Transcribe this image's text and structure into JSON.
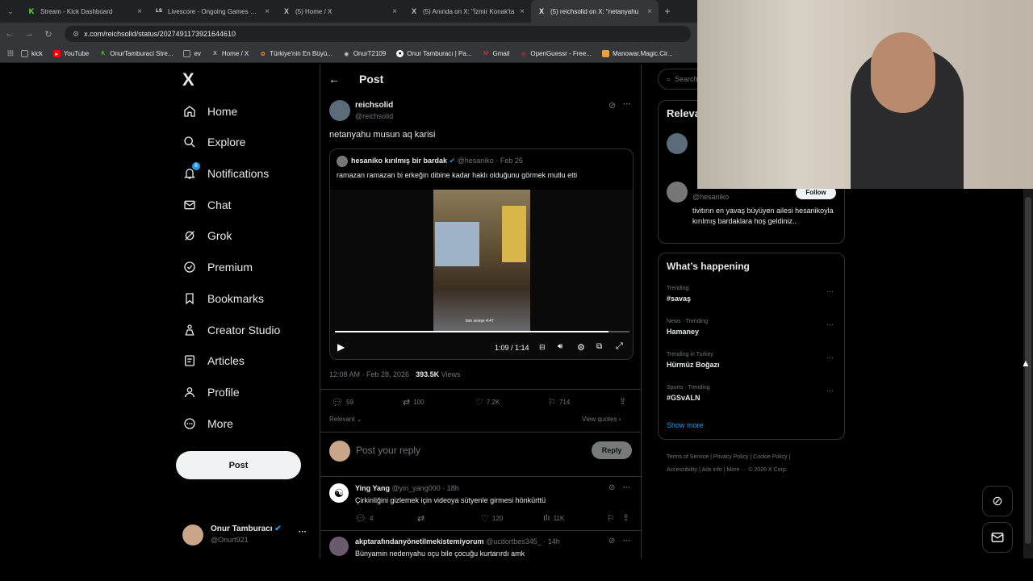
{
  "browser": {
    "tabs": [
      {
        "label": "Stream - Kick Dashboard",
        "icon": "K",
        "active": false
      },
      {
        "label": "Livescore - Ongoing Games and",
        "icon": "LS",
        "active": false
      },
      {
        "label": "(5) Home / X",
        "icon": "X",
        "active": false
      },
      {
        "label": "(5) Anında on X: \"İzmir Konak'ta",
        "icon": "X",
        "active": false
      },
      {
        "label": "(5) reichsolid on X: \"netanyahu",
        "icon": "X",
        "active": true
      }
    ],
    "new_tab": "+",
    "url": "x.com/reichsolid/status/2027491173921644610",
    "bookmarks": [
      "kick",
      "YouTube",
      "OnurTamburaci Stre...",
      "ev",
      "Home / X",
      "Türkiye'nin En Büyü...",
      "OnurT2109",
      "Onur Tamburacı | Pa...",
      "Gmail",
      "OpenGuessr - Free...",
      "Manowar.Magic.Cir..."
    ]
  },
  "sidebar": {
    "logo": "X",
    "items": [
      {
        "label": "Home",
        "icon": "home-icon"
      },
      {
        "label": "Explore",
        "icon": "search-icon"
      },
      {
        "label": "Notifications",
        "icon": "bell-icon",
        "badge": "6"
      },
      {
        "label": "Chat",
        "icon": "mail-icon"
      },
      {
        "label": "Grok",
        "icon": "grok-icon"
      },
      {
        "label": "Premium",
        "icon": "verified-icon"
      },
      {
        "label": "Bookmarks",
        "icon": "bookmark-icon"
      },
      {
        "label": "Creator Studio",
        "icon": "creator-icon"
      },
      {
        "label": "Articles",
        "icon": "article-icon"
      },
      {
        "label": "Profile",
        "icon": "person-icon"
      },
      {
        "label": "More",
        "icon": "more-circle-icon"
      }
    ],
    "post_button": "Post",
    "account": {
      "name": "Onur Tamburacı",
      "handle": "@Onurt921",
      "more": "···"
    }
  },
  "post": {
    "header": "Post",
    "author": {
      "name": "reichsolid",
      "handle": "@reichsolid"
    },
    "text": "netanyahu musun aq karisi",
    "quote": {
      "name": "hesaniko kırılmış bir bardak",
      "handle": "@hesaniko",
      "date": "· Feb 26",
      "text": "ramazan ramazan bi erkeğin dibine kadar haklı olduğunu görmek mutlu etti",
      "video_time": "1:09 / 1:14",
      "video_caption": "bim sevişe 4:47",
      "progress": 0.93
    },
    "meta_time": "12:08 AM · Feb 28, 2026 · ",
    "views_count": "393.5K",
    "views_label": " Views",
    "stats": {
      "replies": "59",
      "reposts": "100",
      "likes": "7.2K",
      "bookmarks": "714"
    },
    "relevant": "Relevant",
    "view_quotes": "View quotes",
    "reply_placeholder": "Post your reply",
    "reply_button": "Reply"
  },
  "replies": [
    {
      "name": "Ying Yang",
      "handle": "@yin_yang000",
      "time": "· 18h",
      "text": "Çirkinliğini gizlemek için videoya sütyenle girmesi hönkürttü",
      "stats": {
        "replies": "4",
        "likes": "120",
        "views": "11K"
      }
    },
    {
      "name": "akptarafındanyönetilmekistemiyorum",
      "handle": "@ucdortbes345_",
      "time": "· 14h",
      "text": "Bünyamin nedenyahu oçu bile çocuğu kurtarırdı amk"
    }
  ],
  "right": {
    "search_placeholder": "Search",
    "relevant_title": "Relevant people",
    "person2_handle": "@hesaniko",
    "person2_bio": "tivitırın en yavaş büyüyen ailesi hesanikoyla kırılmış bardaklara hoş geldiniz..",
    "follow": "Follow",
    "happening_title": "What’s happening",
    "trends": [
      {
        "category": "Trending",
        "name": "#savaş"
      },
      {
        "category": "News · Trending",
        "name": "Hamaney"
      },
      {
        "category": "Trending in Turkey",
        "name": "Hürmüz Boğazı"
      },
      {
        "category": "Sports · Trending",
        "name": "#GSvALN"
      }
    ],
    "show_more": "Show more",
    "footer_line1": [
      "Terms of Service",
      "Privacy Policy",
      "Cookie Policy"
    ],
    "footer_line2": [
      "Accessibility",
      "Ads info",
      "More ···",
      "© 2026 X Corp."
    ]
  },
  "colors": {
    "accent": "#1d9bf0",
    "background": "#000000",
    "border": "#2f3336",
    "muted": "#71767b"
  }
}
